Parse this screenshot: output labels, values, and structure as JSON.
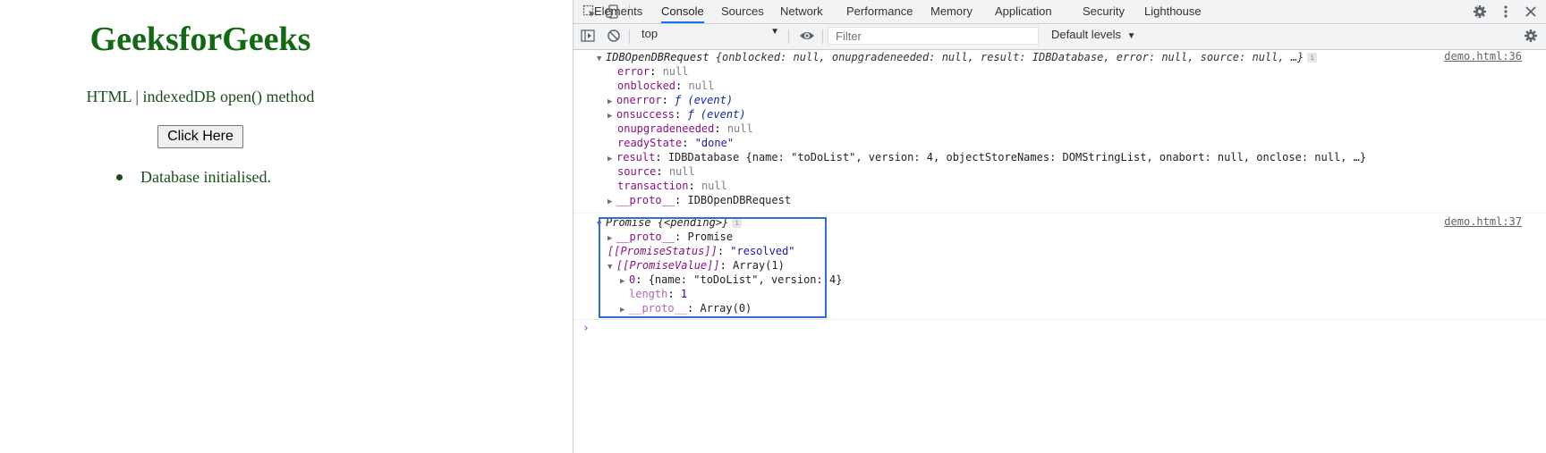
{
  "page": {
    "title": "GeeksforGeeks",
    "subtitle": "HTML | indexedDB open() method",
    "button_label": "Click Here",
    "results": [
      "Database initialised."
    ]
  },
  "devtools": {
    "tabs": [
      "Elements",
      "Console",
      "Sources",
      "Network",
      "Performance",
      "Memory",
      "Application",
      "Security",
      "Lighthouse"
    ],
    "active_tab": "Console",
    "context": "top",
    "filter_placeholder": "Filter",
    "levels_label": "Default levels",
    "accent_color": "#1a73e8"
  },
  "console": {
    "msg1": {
      "source": "demo.html:36",
      "header_class": "IDBOpenDBRequest",
      "header_preview": "{onblocked: null, onupgradeneeded: null, result: IDBDatabase, error: null, source: null, …}",
      "props": [
        {
          "key": "error",
          "value": "null"
        },
        {
          "key": "onblocked",
          "value": "null"
        },
        {
          "key": "onerror",
          "value": "ƒ (event)"
        },
        {
          "key": "onsuccess",
          "value": "ƒ (event)"
        },
        {
          "key": "onupgradeneeded",
          "value": "null"
        },
        {
          "key": "readyState",
          "value": "\"done\""
        },
        {
          "key": "result",
          "value": "IDBDatabase {name: \"toDoList\", version: 4, objectStoreNames: DOMStringList, onabort: null, onclose: null, …}"
        },
        {
          "key": "source",
          "value": "null"
        },
        {
          "key": "transaction",
          "value": "null"
        },
        {
          "key": "__proto__",
          "value": "IDBOpenDBRequest"
        }
      ]
    },
    "msg2": {
      "source": "demo.html:37",
      "header": "Promise",
      "header_preview": "{<pending>}",
      "proto_key": "__proto__",
      "proto_value": "Promise",
      "status_key": "[[PromiseStatus]]",
      "status_value": "\"resolved\"",
      "value_key": "[[PromiseValue]]",
      "value_value": "Array(1)",
      "item0_key": "0",
      "item0_value": "{name: \"toDoList\", version: 4}",
      "length_key": "length",
      "length_value": "1",
      "arr_proto_key": "__proto__",
      "arr_proto_value": "Array(0)"
    }
  }
}
